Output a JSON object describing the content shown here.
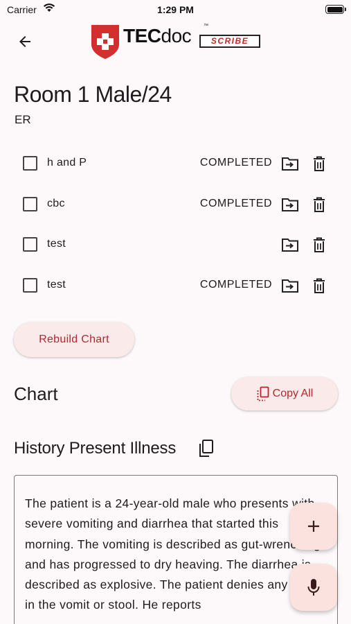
{
  "status_bar": {
    "carrier": "Carrier",
    "time": "1:29 PM"
  },
  "header": {
    "logo_brand_bold": "TEC",
    "logo_brand_rest": "doc",
    "logo_tm": "™",
    "logo_badge": "SCRIBE"
  },
  "patient": {
    "title": "Room 1 Male/24",
    "location": "ER"
  },
  "tasks": [
    {
      "name": "h and P",
      "status": "COMPLETED"
    },
    {
      "name": "cbc",
      "status": "COMPLETED"
    },
    {
      "name": "test",
      "status": ""
    },
    {
      "name": "test",
      "status": "COMPLETED"
    }
  ],
  "actions": {
    "rebuild_label": "Rebuild Chart",
    "copy_all_label": "Copy All"
  },
  "chart": {
    "heading": "Chart",
    "sections": [
      {
        "heading": "History Present Illness",
        "text": "The patient is a 24-year-old male who presents with severe vomiting and diarrhea that started this morning. The vomiting is described as gut-wrenching and has progressed to dry heaving. The diarrhea is described as explosive. The patient denies any blood in the vomit or stool. He reports"
      }
    ]
  },
  "colors": {
    "accent": "#b3262e",
    "button_bg": "#fbeaea",
    "fab_bg": "#fbe2df",
    "background": "#fdf8fa"
  },
  "icons": [
    "wifi-icon",
    "battery-icon",
    "back-arrow-icon",
    "logo-shield-icon",
    "move-to-folder-icon",
    "delete-icon",
    "copy-icon",
    "add-icon",
    "microphone-icon"
  ]
}
